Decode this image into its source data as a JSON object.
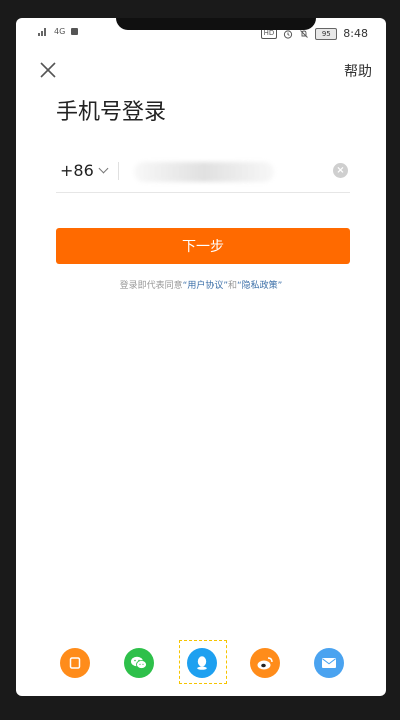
{
  "status_bar": {
    "network_label": "4G",
    "hd_label": "HD",
    "battery_level": "95",
    "time": "8:48"
  },
  "header": {
    "help_label": "帮助"
  },
  "page": {
    "title": "手机号登录"
  },
  "phone_input": {
    "country_code": "+86",
    "value": ""
  },
  "next_button": {
    "label": "下一步"
  },
  "agreement": {
    "prefix": "登录即代表同意",
    "user_agreement": "“用户协议”",
    "and": "和",
    "privacy_policy": "“隐私政策”"
  },
  "social_login": [
    {
      "name": "tablet-login",
      "color": "#ff8c1a"
    },
    {
      "name": "wechat-login",
      "color": "#2ec04a"
    },
    {
      "name": "qq-login",
      "color": "#1ea0f0"
    },
    {
      "name": "weibo-login",
      "color": "#ff8c1a"
    },
    {
      "name": "mail-login",
      "color": "#4aa3f0"
    }
  ]
}
